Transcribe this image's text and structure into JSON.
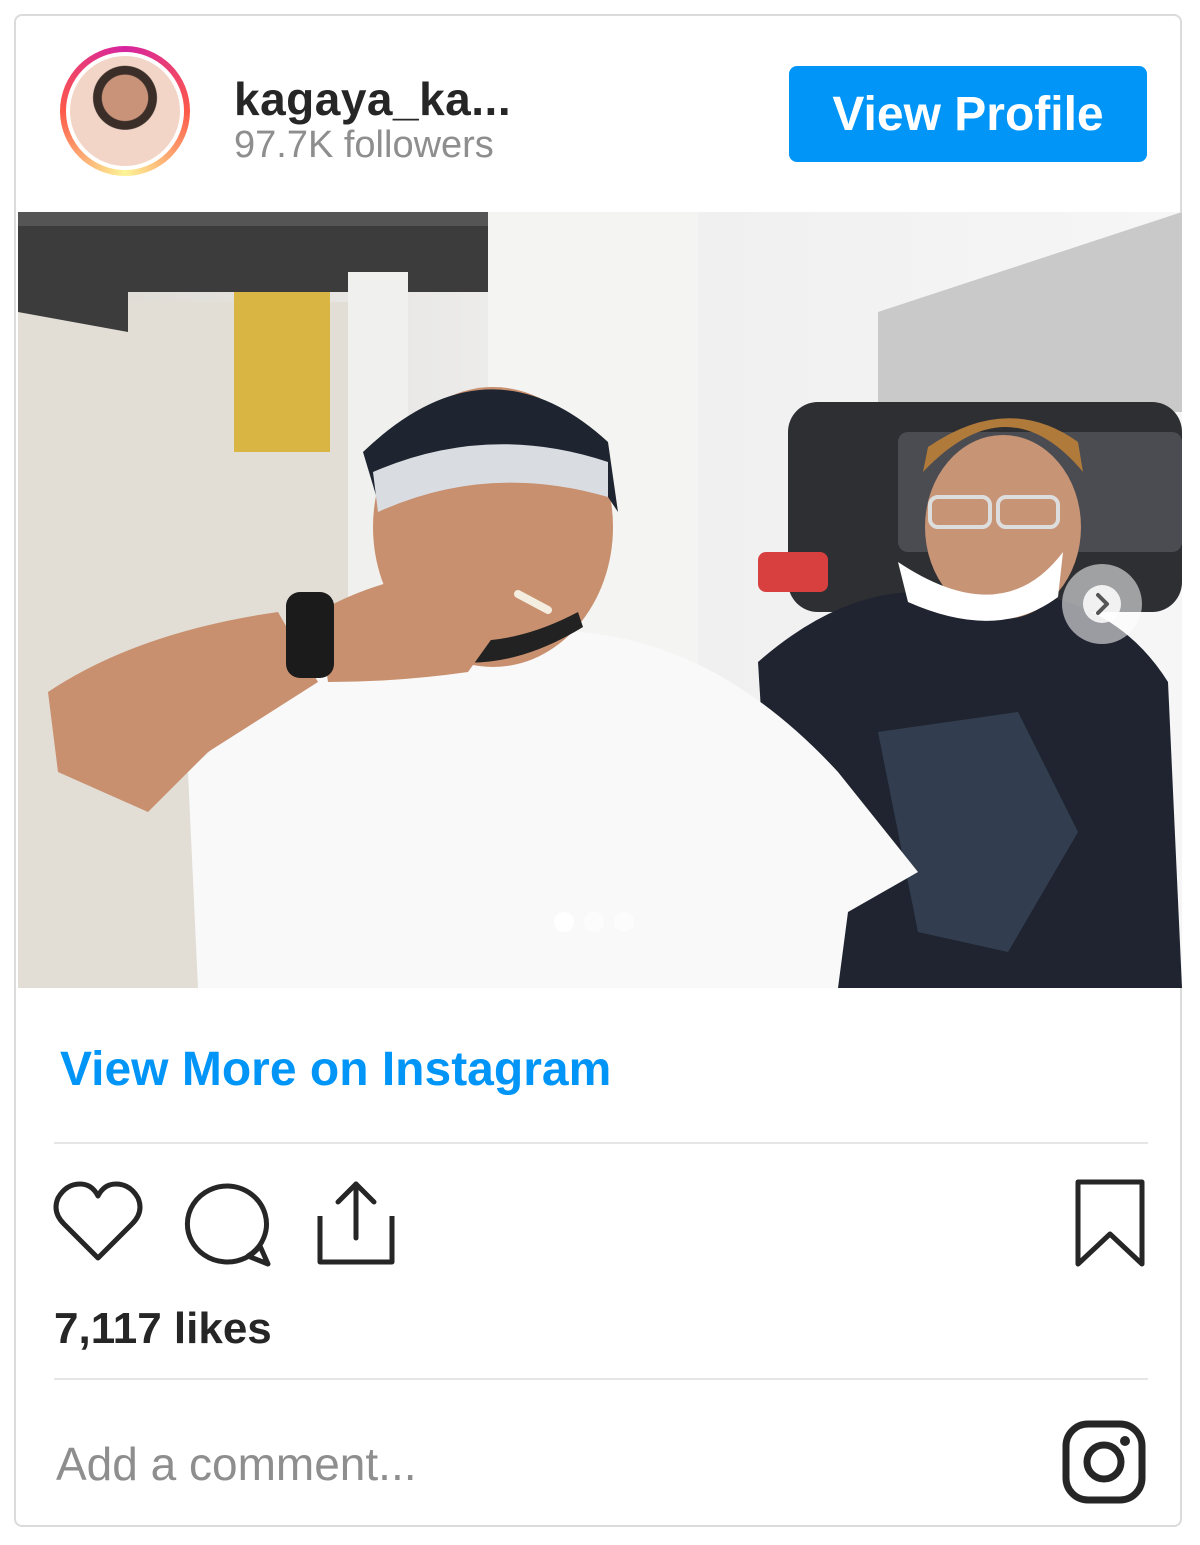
{
  "header": {
    "username": "kagaya_ka...",
    "followers": "97.7K followers",
    "view_profile_label": "View Profile"
  },
  "post": {
    "carousel_index": 1,
    "carousel_total": 3
  },
  "links": {
    "view_more": "View More on Instagram"
  },
  "engagement": {
    "likes": "7,117 likes"
  },
  "comment": {
    "placeholder": "Add a comment..."
  },
  "icons": [
    "heart-icon",
    "comment-icon",
    "share-icon",
    "bookmark-icon",
    "chevron-right-icon",
    "instagram-logo-icon"
  ],
  "colors": {
    "accent": "#0095f6",
    "text": "#262626",
    "muted": "#8e8e8e",
    "border": "#dbdbdb"
  }
}
